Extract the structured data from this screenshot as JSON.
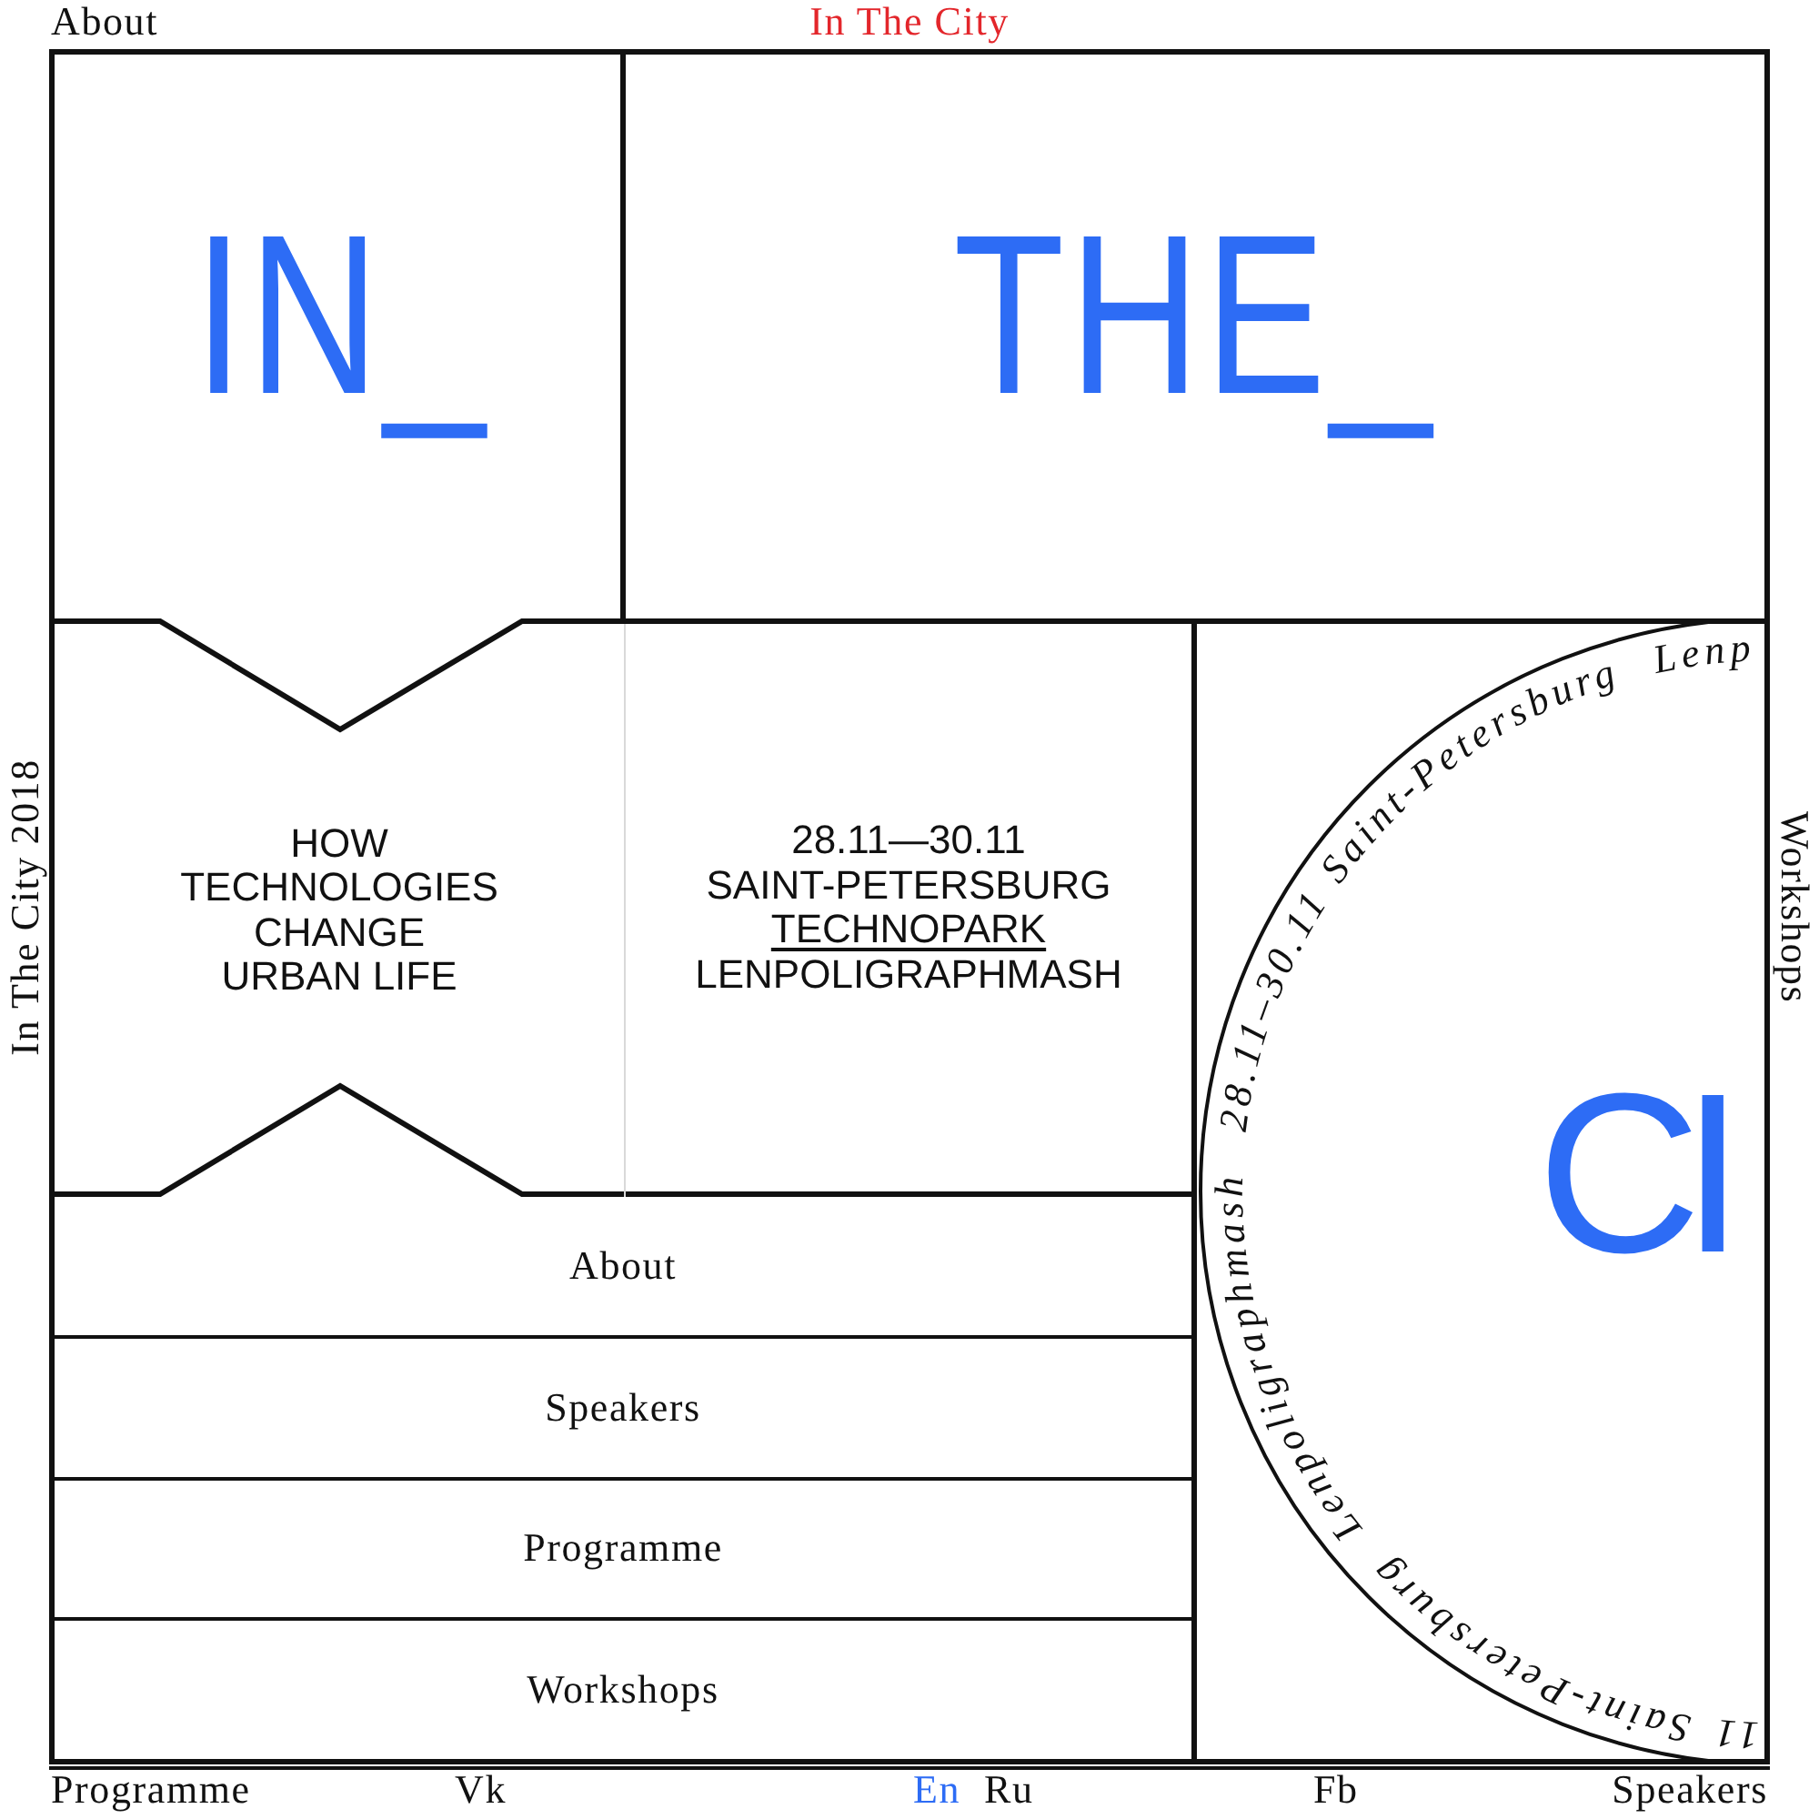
{
  "top_bar": {
    "about_link": "About",
    "site_title": "In The City"
  },
  "side_labels": {
    "left": "In The City 2018",
    "right": "Workshops"
  },
  "headline": {
    "words": [
      "IN_",
      "THE_"
    ]
  },
  "tagline": "HOW\nTECHNOLOGIES\nCHANGE\nURBAN LIFE",
  "event_info": [
    {
      "kind": "text",
      "text": "28.11—30.11"
    },
    {
      "kind": "text",
      "text": "SAINT-PETERSBURG"
    },
    {
      "kind": "link",
      "text": "TECHNOPARK"
    },
    {
      "kind": "text",
      "text": "LENPOLIGRAPHMASH"
    }
  ],
  "circle_badge": {
    "ring_texts": [
      "Lenp",
      "Saint-Petersburg",
      "28.11–30.11",
      "Lenpoligraphmash",
      "Saint-Petersburg",
      "11"
    ],
    "big_text": "CI"
  },
  "menu": [
    "About",
    "Speakers",
    "Programme",
    "Workshops"
  ],
  "bottom_bar": {
    "left_links": [
      "Programme",
      "Vk"
    ],
    "languages": [
      {
        "label": "En",
        "selected": true
      },
      {
        "label": "Ru",
        "selected": false
      }
    ],
    "right_links": [
      "Fb",
      "Speakers"
    ]
  }
}
